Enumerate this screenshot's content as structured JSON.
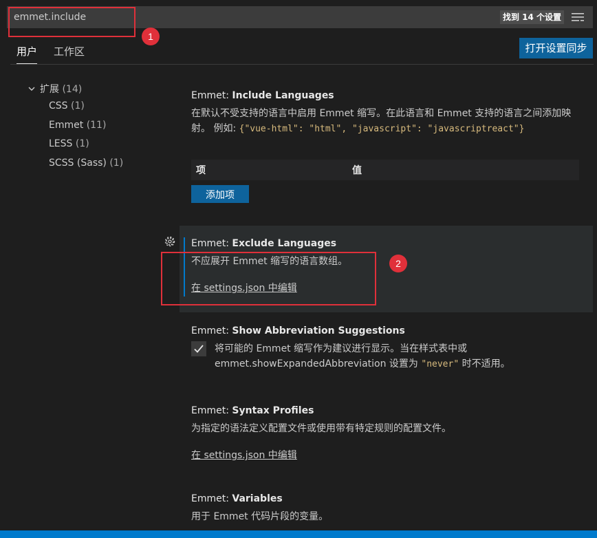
{
  "search": {
    "value": "emmet.include",
    "result_count": "找到 14 个设置",
    "filter_icon": "filter-list-icon"
  },
  "annotations": [
    "1",
    "2"
  ],
  "tabs": [
    {
      "label": "用户",
      "active": true
    },
    {
      "label": "工作区",
      "active": false
    }
  ],
  "sync_button": "打开设置同步",
  "tree": {
    "root": {
      "label": "扩展",
      "count": "(14)"
    },
    "children": [
      {
        "label": "CSS",
        "count": "(1)"
      },
      {
        "label": "Emmet",
        "count": "(11)"
      },
      {
        "label": "LESS",
        "count": "(1)"
      },
      {
        "label": "SCSS (Sass)",
        "count": "(1)"
      }
    ]
  },
  "settings": {
    "include": {
      "prefix": "Emmet: ",
      "name": "Include Languages",
      "desc_text": "在默认不受支持的语言中启用 Emmet 缩写。在此语言和 Emmet 支持的语言之间添加映射。 例如: ",
      "desc_code": "{\"vue-html\": \"html\", \"javascript\": \"javascriptreact\"}",
      "col_item": "项",
      "col_value": "值",
      "add_button": "添加项"
    },
    "exclude": {
      "prefix": "Emmet: ",
      "name": "Exclude Languages",
      "desc": "不应展开 Emmet 缩写的语言数组。",
      "link": "在 settings.json 中编辑"
    },
    "suggestions": {
      "prefix": "Emmet: ",
      "name": "Show Abbreviation Suggestions",
      "desc_1": "将可能的 Emmet 缩写作为建议进行显示。当在样式表中或",
      "desc_2": "emmet.showExpandedAbbreviation 设置为 ",
      "desc_code": "\"never\"",
      "desc_3": " 时不适用。",
      "checked": true
    },
    "syntax": {
      "prefix": "Emmet: ",
      "name": "Syntax Profiles",
      "desc": "为指定的语法定义配置文件或使用带有特定规则的配置文件。",
      "link": "在 settings.json 中编辑"
    },
    "variables": {
      "prefix": "Emmet: ",
      "name": "Variables",
      "desc": "用于 Emmet 代码片段的变量。"
    }
  },
  "colors": {
    "background": "#1e1e1e",
    "accent": "#0e639c",
    "annotation": "#e0303a",
    "focus": "#007acc"
  }
}
